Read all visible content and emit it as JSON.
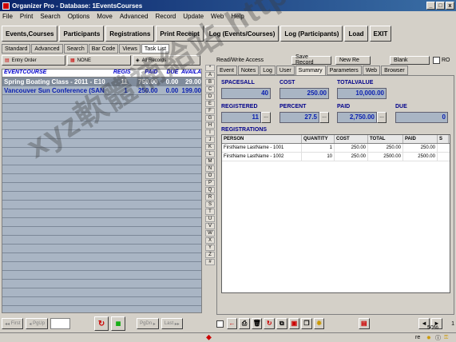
{
  "window": {
    "title": "Organizer Pro - Database: 1EventsCourses",
    "min": "_",
    "max": "□",
    "close": "x"
  },
  "menu": [
    "File",
    "Print",
    "Search",
    "Options",
    "Move",
    "Advanced",
    "Record",
    "Update",
    "Web",
    "Help"
  ],
  "toolbar": [
    "Events,Courses",
    "Participants",
    "Registrations",
    "Print Receipt",
    "Log (Events/Courses)",
    "Log (Participants)",
    "Load",
    "EXIT"
  ],
  "subtabs": [
    "Standard",
    "Advanced",
    "Search",
    "Bar Code",
    "Views",
    "Task List"
  ],
  "left": {
    "buttons": [
      "Entry Order",
      "NONE",
      "All Records"
    ],
    "headers": {
      "event": "EVENTCOURSE",
      "regis": "REGIS",
      "paid": "PAID",
      "due": "DUE",
      "avail": "AVAILA"
    },
    "rows": [
      {
        "event": "Spring Boating Class - 2011 - E10",
        "regis": "11",
        "paid": "750.00",
        "due": "0.00",
        "avail": "29.00"
      },
      {
        "event": "Vancouver Sun Conference (SAN",
        "regis": "1",
        "paid": "250.00",
        "due": "0.00",
        "avail": "199.00"
      }
    ],
    "footer": {
      "first": "First",
      "pgup": "PgUp",
      "pgdn": "PgDn",
      "last": "Last"
    }
  },
  "alphabet": [
    "*",
    "A",
    "B",
    "C",
    "D",
    "E",
    "F",
    "G",
    "H",
    "I",
    "J",
    "K",
    "L",
    "M",
    "N",
    "O",
    "P",
    "Q",
    "R",
    "S",
    "T",
    "U",
    "V",
    "W",
    "X",
    "Y",
    "Z",
    "#"
  ],
  "right": {
    "access": "Read/Write Access",
    "save": "Save Record",
    "newrec": "New Re",
    "blank": "Blank",
    "ro": "RO",
    "tabs": [
      "Event",
      "Notes",
      "Log",
      "User",
      "Summary",
      "Parameters",
      "Web",
      "Browser"
    ],
    "fields": {
      "spacesall_label": "SPACESALL",
      "spacesall": "40",
      "cost_label": "COST",
      "cost": "250.00",
      "totalvalue_label": "TOTALVALUE",
      "totalvalue": "10,000.00",
      "registered_label": "REGISTERED",
      "registered": "11",
      "percent_label": "PERCENT",
      "percent": "27.5",
      "paid_label": "PAID",
      "paid": "2,750.00",
      "due_label": "DUE",
      "due": "0",
      "dots": "..."
    },
    "registrations_label": "REGISTRATIONS",
    "reg_headers": {
      "person": "PERSON",
      "qty": "QUANTITY",
      "cost": "COST",
      "total": "TOTAL",
      "paid": "PAID",
      "x": "S"
    },
    "reg_rows": [
      {
        "person": "FirstName LastName - 1001",
        "qty": "1",
        "cost": "250.00",
        "total": "250.00",
        "paid": "250.00"
      },
      {
        "person": "FirstName LastName - 1002",
        "qty": "10",
        "cost": "250.00",
        "total": "2500.00",
        "paid": "2500.00"
      }
    ]
  },
  "status": {
    "zoom": "50%",
    "pagenum": "1",
    "re": "re"
  },
  "watermark": "xyz軟體補給站 http://l31.to",
  "colors": {
    "title": "#0a246a",
    "list_bg": "#a9b5c4",
    "accent_blue": "#0a1fb0"
  }
}
